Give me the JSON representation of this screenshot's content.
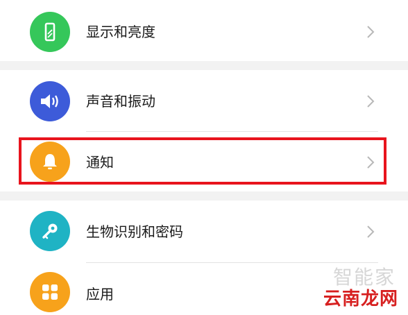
{
  "settings": {
    "items": [
      {
        "label": "显示和亮度",
        "icon": "phone-display-icon",
        "color": "#35c75a"
      },
      {
        "label": "声音和振动",
        "icon": "speaker-icon",
        "color": "#3d5bd9"
      },
      {
        "label": "通知",
        "icon": "bell-icon",
        "color": "#f7a21b",
        "highlighted": true
      },
      {
        "label": "生物识别和密码",
        "icon": "key-icon",
        "color": "#1fb3c4"
      },
      {
        "label": "应用",
        "icon": "apps-grid-icon",
        "color": "#f7a21b"
      }
    ]
  },
  "watermark": {
    "line1": "智能家",
    "line2": "云南龙网"
  }
}
